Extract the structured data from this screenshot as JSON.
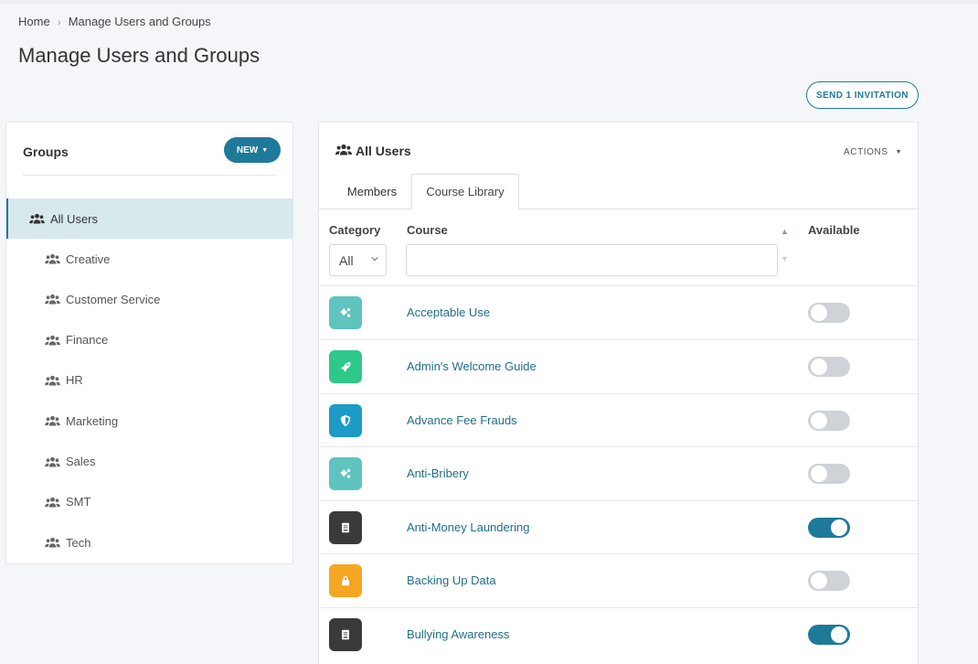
{
  "breadcrumb": {
    "home": "Home",
    "separator": "›",
    "current": "Manage Users and Groups"
  },
  "page": {
    "title": "Manage Users and Groups"
  },
  "header": {
    "send_invitation_label": "SEND 1 INVITATION"
  },
  "groups": {
    "title": "Groups",
    "new_button_label": "NEW",
    "items": [
      {
        "label": "All Users",
        "active": true
      },
      {
        "label": "Creative",
        "active": false
      },
      {
        "label": "Customer Service",
        "active": false
      },
      {
        "label": "Finance",
        "active": false
      },
      {
        "label": "HR",
        "active": false
      },
      {
        "label": "Marketing",
        "active": false
      },
      {
        "label": "Sales",
        "active": false
      },
      {
        "label": "SMT",
        "active": false
      },
      {
        "label": "Tech",
        "active": false
      }
    ]
  },
  "users_panel": {
    "title": "All Users",
    "actions_label": "ACTIONS",
    "tabs": [
      {
        "label": "Members",
        "active": false
      },
      {
        "label": "Course Library",
        "active": true
      }
    ]
  },
  "table": {
    "columns": {
      "category": "Category",
      "course": "Course",
      "available": "Available"
    },
    "category_filter_value": "All",
    "course_filter_value": "",
    "rows": [
      {
        "name": "Acceptable Use",
        "icon": "gears-icon",
        "icon_color": "#5fc3c0",
        "available": false
      },
      {
        "name": "Admin's Welcome Guide",
        "icon": "rocket-icon",
        "icon_color": "#2ec98a",
        "available": false
      },
      {
        "name": "Advance Fee Frauds",
        "icon": "shield-icon",
        "icon_color": "#1c9bc7",
        "available": false
      },
      {
        "name": "Anti-Bribery",
        "icon": "gears-icon",
        "icon_color": "#5fc3c0",
        "available": false
      },
      {
        "name": "Anti-Money Laundering",
        "icon": "book-icon",
        "icon_color": "#3a3a3a",
        "available": true
      },
      {
        "name": "Backing Up Data",
        "icon": "lock-icon",
        "icon_color": "#f5a623",
        "available": false
      },
      {
        "name": "Bullying Awareness",
        "icon": "book-icon",
        "icon_color": "#3a3a3a",
        "available": true
      }
    ]
  },
  "colors": {
    "accent": "#1f7a99",
    "active_group_bg": "#d8e9ee",
    "link": "#1f6f8b"
  }
}
